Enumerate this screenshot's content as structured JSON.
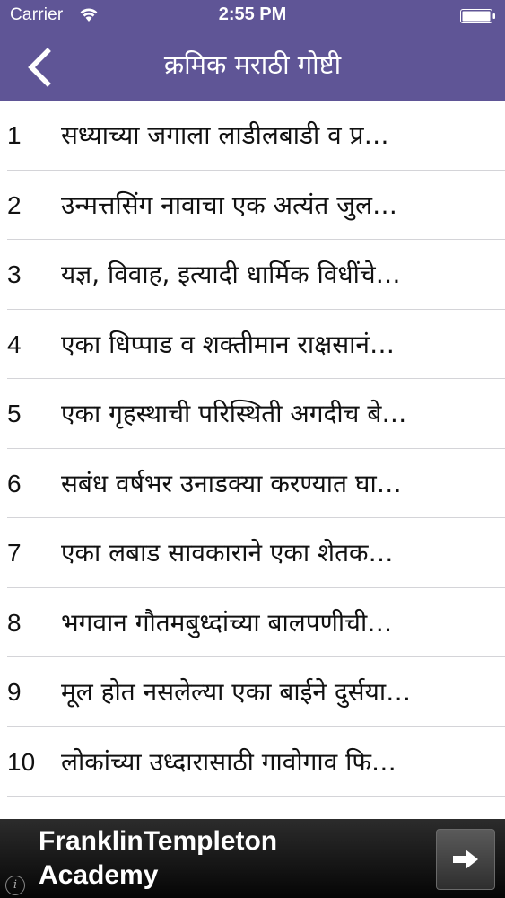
{
  "status_bar": {
    "carrier": "Carrier",
    "time": "2:55 PM",
    "icons": [
      "wifi-icon",
      "battery-icon"
    ]
  },
  "nav_bar": {
    "title": "क्रमिक मराठी गोष्टी",
    "back_icon": "chevron-left-icon"
  },
  "list": {
    "items": [
      {
        "number": "1",
        "text": "सध्याच्या जगाला लाडीलबाडी व प्र…"
      },
      {
        "number": "2",
        "text": "उन्मत्तसिंग नावाचा एक अत्यंत जुल…"
      },
      {
        "number": "3",
        "text": "यज्ञ, विवाह, इत्यादी धार्मिक विधींचे…"
      },
      {
        "number": "4",
        "text": "एका धिप्पाड व शक्तीमान राक्षसानं…"
      },
      {
        "number": "5",
        "text": "एका गृहस्थाची परिस्थिती अगदीच बे…"
      },
      {
        "number": "6",
        "text": "सबंध वर्षभर उनाडक्या करण्यात घा…"
      },
      {
        "number": "7",
        "text": "एका लबाड सावकाराने एका शेतक…"
      },
      {
        "number": "8",
        "text": "भगवान गौतमबुध्दांच्या बालपणीची…"
      },
      {
        "number": "9",
        "text": "मूल होत नसलेल्या एका बाईने दुर्सया…"
      },
      {
        "number": "10",
        "text": "लोकांच्या उध्दारासाठी गावोगाव फि…"
      }
    ]
  },
  "ad": {
    "line1": "FranklinTempleton",
    "line2": "Academy",
    "info_icon": "info-icon",
    "arrow_icon": "arrow-right-icon"
  },
  "colors": {
    "header_bg": "#5f5596",
    "separator": "#d4d4d8",
    "ad_bg": "#111111"
  }
}
